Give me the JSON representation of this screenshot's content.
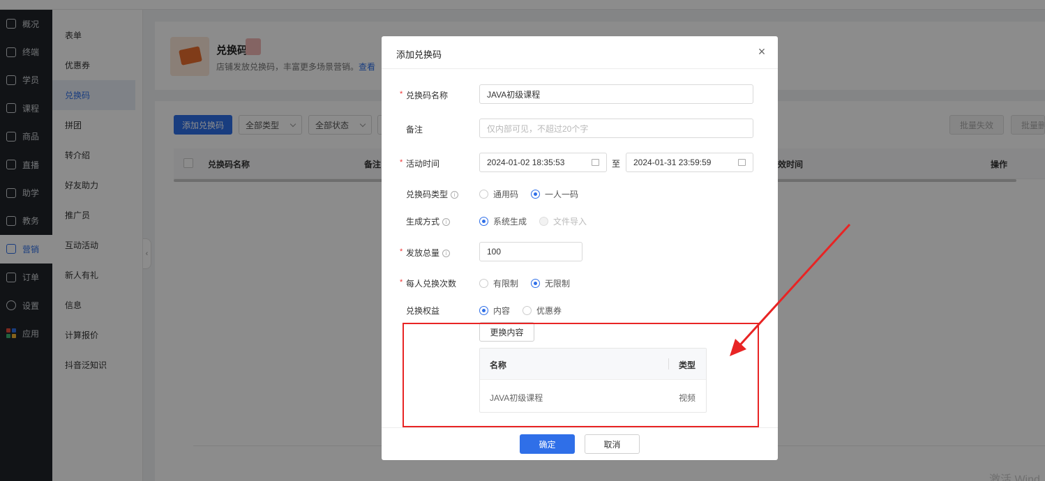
{
  "nav_primary": [
    {
      "label": "概况",
      "icon": "grid-icon"
    },
    {
      "label": "终端",
      "icon": "terminal-icon"
    },
    {
      "label": "学员",
      "icon": "users-icon"
    },
    {
      "label": "课程",
      "icon": "course-icon"
    },
    {
      "label": "商品",
      "icon": "goods-icon"
    },
    {
      "label": "直播",
      "icon": "live-icon"
    },
    {
      "label": "助学",
      "icon": "assist-icon"
    },
    {
      "label": "教务",
      "icon": "academic-icon"
    },
    {
      "label": "营销",
      "icon": "marketing-icon",
      "active": true
    },
    {
      "label": "订单",
      "icon": "order-icon"
    },
    {
      "label": "设置",
      "icon": "settings-icon"
    },
    {
      "label": "应用",
      "icon": "apps-icon"
    }
  ],
  "nav_secondary": [
    {
      "label": "表单"
    },
    {
      "label": "优惠券"
    },
    {
      "label": "兑换码",
      "active": true
    },
    {
      "label": "拼团"
    },
    {
      "label": "转介绍"
    },
    {
      "label": "好友助力"
    },
    {
      "label": "推广员"
    },
    {
      "label": "互动活动"
    },
    {
      "label": "新人有礼"
    },
    {
      "label": "信息"
    },
    {
      "label": "计算报价"
    },
    {
      "label": "抖音泛知识"
    }
  ],
  "header": {
    "title": "兑换码",
    "desc": "店铺发放兑换码，丰富更多场景营销。",
    "link": "查看"
  },
  "toolbar": {
    "add_button": "添加兑换码",
    "filter_type": "全部类型",
    "filter_status": "全部状态",
    "batch_invalid": "批量失效",
    "batch_other": "批量删"
  },
  "table": {
    "columns": [
      "兑换码名称",
      "备注",
      "效时间",
      "操作"
    ]
  },
  "watermark": "激活 Wind",
  "modal": {
    "title": "添加兑换码",
    "fields": {
      "name_label": "兑换码名称",
      "name_value": "JAVA初级课程",
      "remark_label": "备注",
      "remark_placeholder": "仅内部可见，不超过20个字",
      "time_label": "活动时间",
      "start_time": "2024-01-02 18:35:53",
      "to": "至",
      "end_time": "2024-01-31 23:59:59",
      "code_type_label": "兑换码类型",
      "code_type_options": [
        "通用码",
        "一人一码"
      ],
      "code_type_selected": "一人一码",
      "gen_label": "生成方式",
      "gen_options": [
        "系统生成",
        "文件导入"
      ],
      "gen_selected": "系统生成",
      "total_label": "发放总量",
      "total_value": "100",
      "per_user_label": "每人兑换次数",
      "per_user_options": [
        "有限制",
        "无限制"
      ],
      "per_user_selected": "无限制",
      "benefit_label": "兑换权益",
      "benefit_options": [
        "内容",
        "优惠券"
      ],
      "benefit_selected": "内容",
      "change_content_button": "更换内容"
    },
    "content_table": {
      "headers": [
        "名称",
        "类型"
      ],
      "rows": [
        {
          "name": "JAVA初级课程",
          "type": "视频"
        }
      ]
    },
    "confirm_button": "确定",
    "cancel_button": "取消"
  },
  "colors": {
    "primary": "#2f6fe8",
    "annotation_red": "#e82424",
    "nav_dark": "#1f2329"
  }
}
